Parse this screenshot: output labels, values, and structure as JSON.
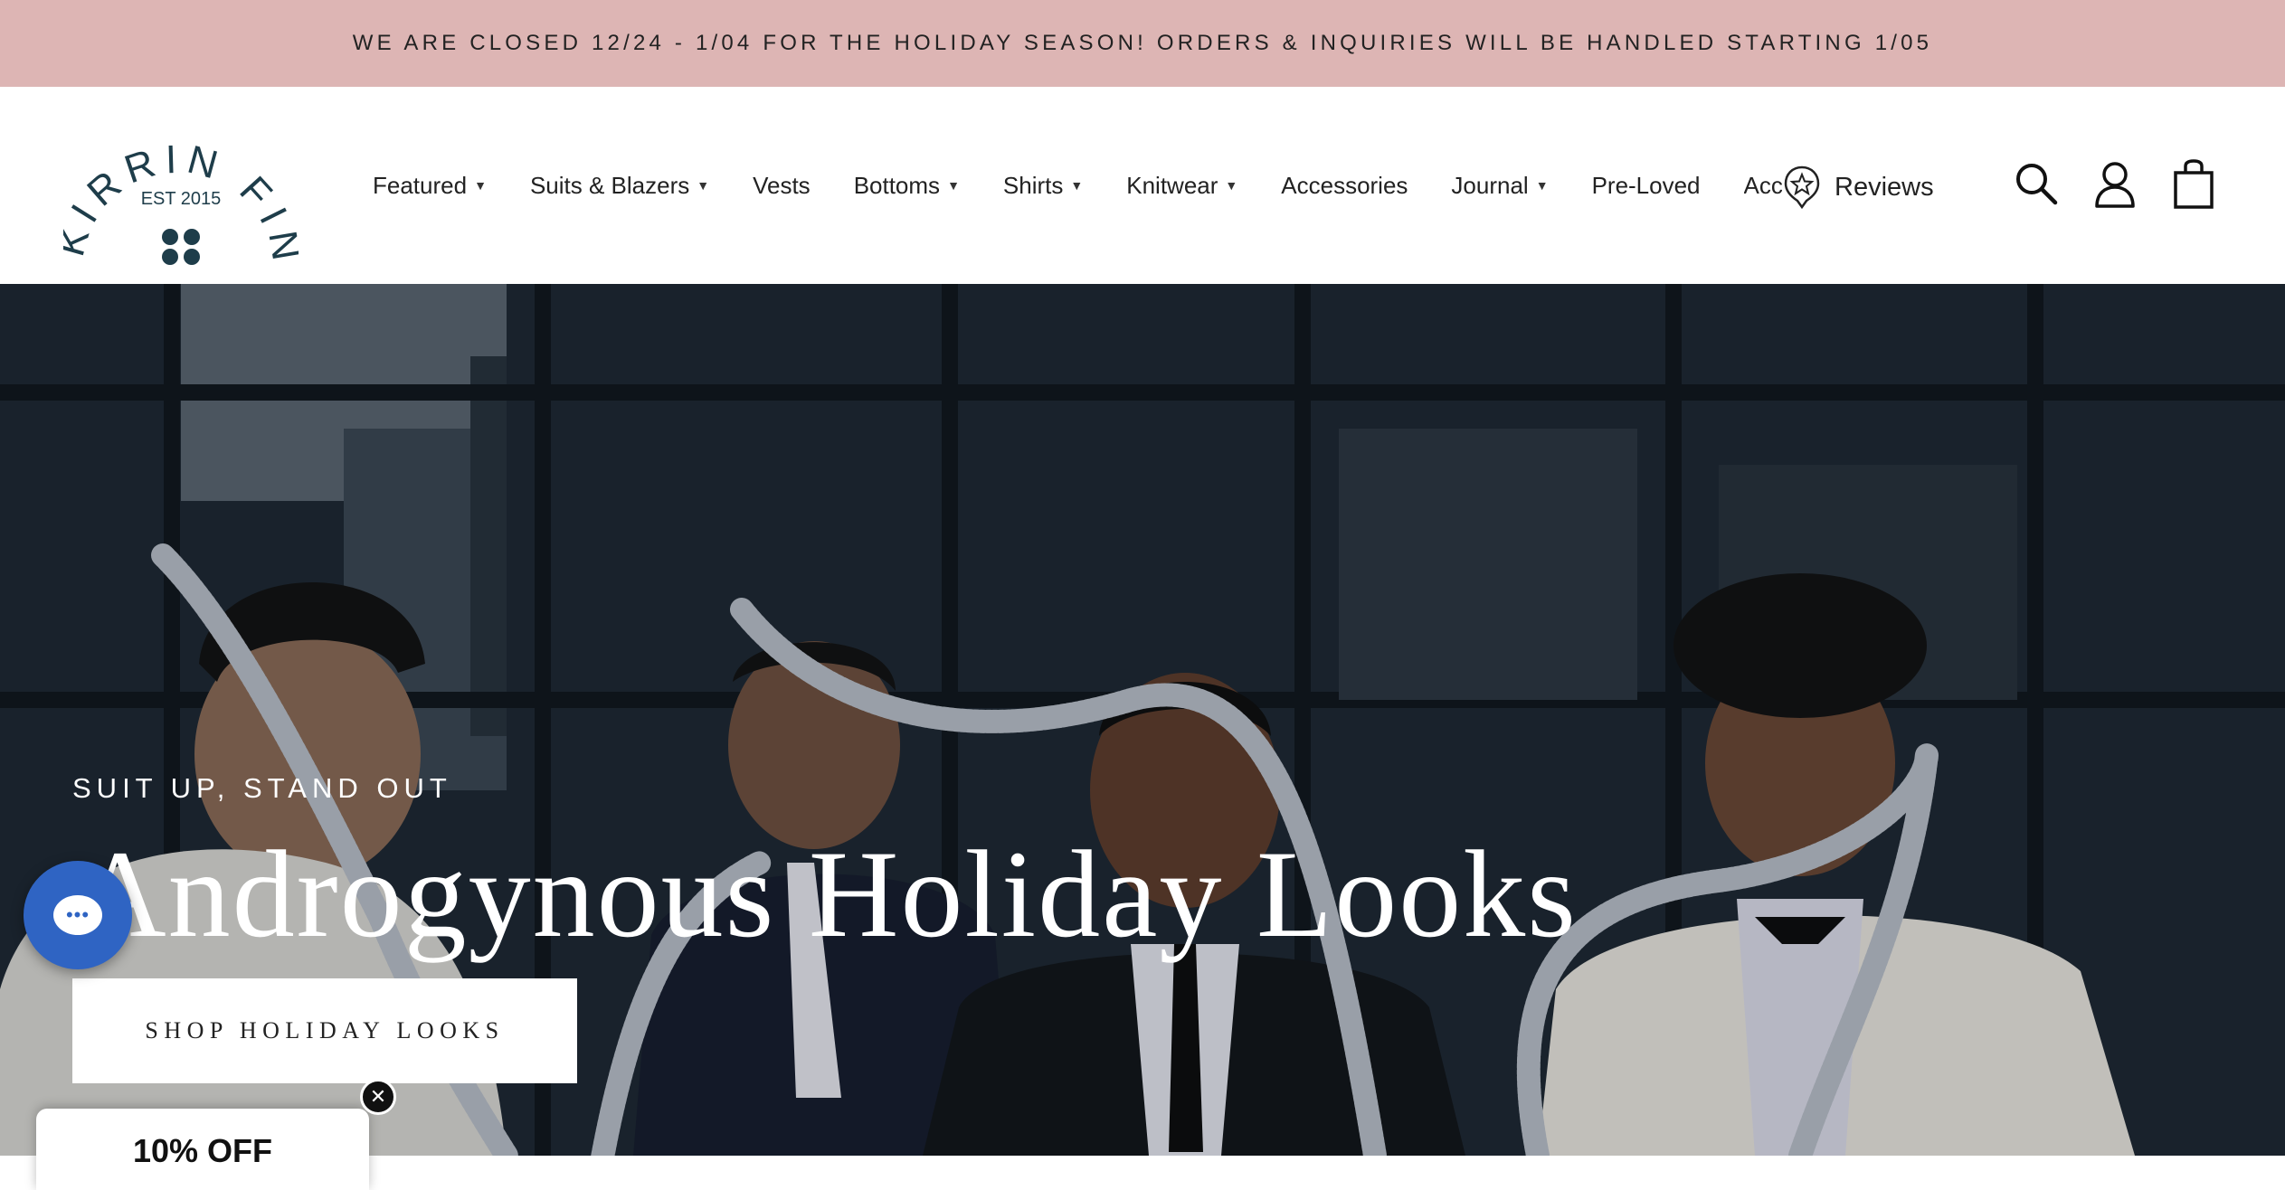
{
  "announcement": "WE ARE CLOSED 12/24 - 1/04 FOR THE HOLIDAY SEASON! ORDERS & INQUIRIES WILL BE HANDLED STARTING 1/05",
  "logo": {
    "brand": "KIRRIN FINCH",
    "established": "EST 2015",
    "color": "#1e3d4a"
  },
  "nav": [
    {
      "label": "Featured",
      "dropdown": true
    },
    {
      "label": "Suits & Blazers",
      "dropdown": true
    },
    {
      "label": "Vests",
      "dropdown": false
    },
    {
      "label": "Bottoms",
      "dropdown": true
    },
    {
      "label": "Shirts",
      "dropdown": true
    },
    {
      "label": "Knitwear",
      "dropdown": true
    },
    {
      "label": "Accessories",
      "dropdown": false
    },
    {
      "label": "Journal",
      "dropdown": true
    },
    {
      "label": "Pre-Loved",
      "dropdown": false
    },
    {
      "label": "Accessibility",
      "dropdown": false
    }
  ],
  "reviews_label": "Reviews",
  "header_icons": [
    "search-icon",
    "account-icon",
    "cart-icon"
  ],
  "hero": {
    "eyebrow": "SUIT UP, STAND OUT",
    "title": "Androgynous Holiday Looks",
    "cta": "SHOP HOLIDAY LOOKS"
  },
  "chat_icon": "chat-icon",
  "discount": {
    "label": "10% OFF",
    "close_icon": "close-icon"
  },
  "colors": {
    "announcement_bg": "#ddb5b4",
    "chat_bg": "#2f64c3",
    "text_dark": "#1b1b1b"
  }
}
